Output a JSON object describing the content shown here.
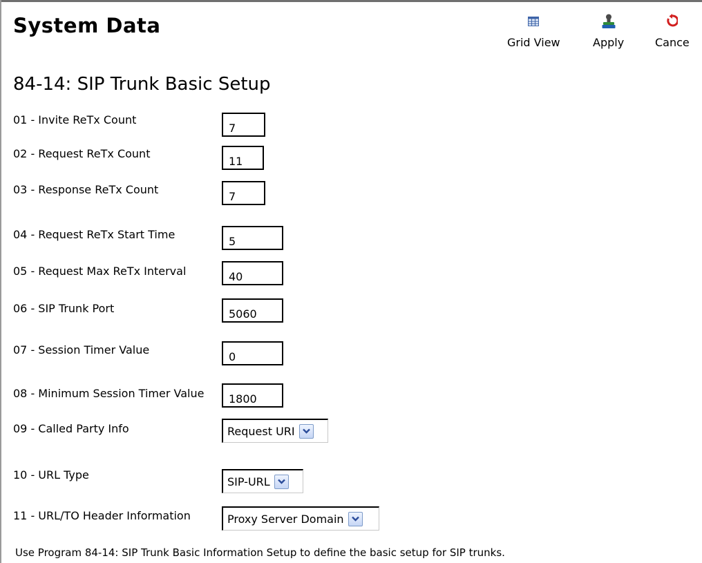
{
  "header": {
    "title": "System Data"
  },
  "toolbar": {
    "grid_view_label": "Grid View",
    "apply_label": "Apply",
    "cancel_label": "Cance"
  },
  "page": {
    "title": "84-14: SIP Trunk Basic Setup"
  },
  "fields": [
    {
      "label": "01 - Invite ReTx Count",
      "value": "7"
    },
    {
      "label": "02 - Request ReTx Count",
      "value": "11"
    },
    {
      "label": "03 - Response ReTx Count",
      "value": "7"
    },
    {
      "label": "04 - Request ReTx Start Time",
      "value": "5"
    },
    {
      "label": "05 - Request Max ReTx Interval",
      "value": "40"
    },
    {
      "label": "06 - SIP Trunk Port",
      "value": "5060"
    },
    {
      "label": "07 - Session Timer Value",
      "value": "0"
    },
    {
      "label": "08 - Minimum Session Timer Value",
      "value": "1800"
    },
    {
      "label": "09 - Called Party Info",
      "value": "Request URI"
    },
    {
      "label": "10 - URL Type",
      "value": "SIP-URL"
    },
    {
      "label": "11 - URL/TO Header Information",
      "value": "Proxy Server Domain"
    }
  ],
  "footer": {
    "note": "Use Program 84-14: SIP Trunk Basic Information Setup to define the basic setup for SIP trunks."
  },
  "icons": {
    "grid_view": "grid-icon",
    "apply": "apply-stamp-icon",
    "cancel": "cancel-refresh-icon",
    "dropdown": "chevron-down-icon"
  },
  "colors": {
    "border": "#000000",
    "dropdown_arrow": "#2c4d9a",
    "cancel_icon": "#d21f1f"
  }
}
